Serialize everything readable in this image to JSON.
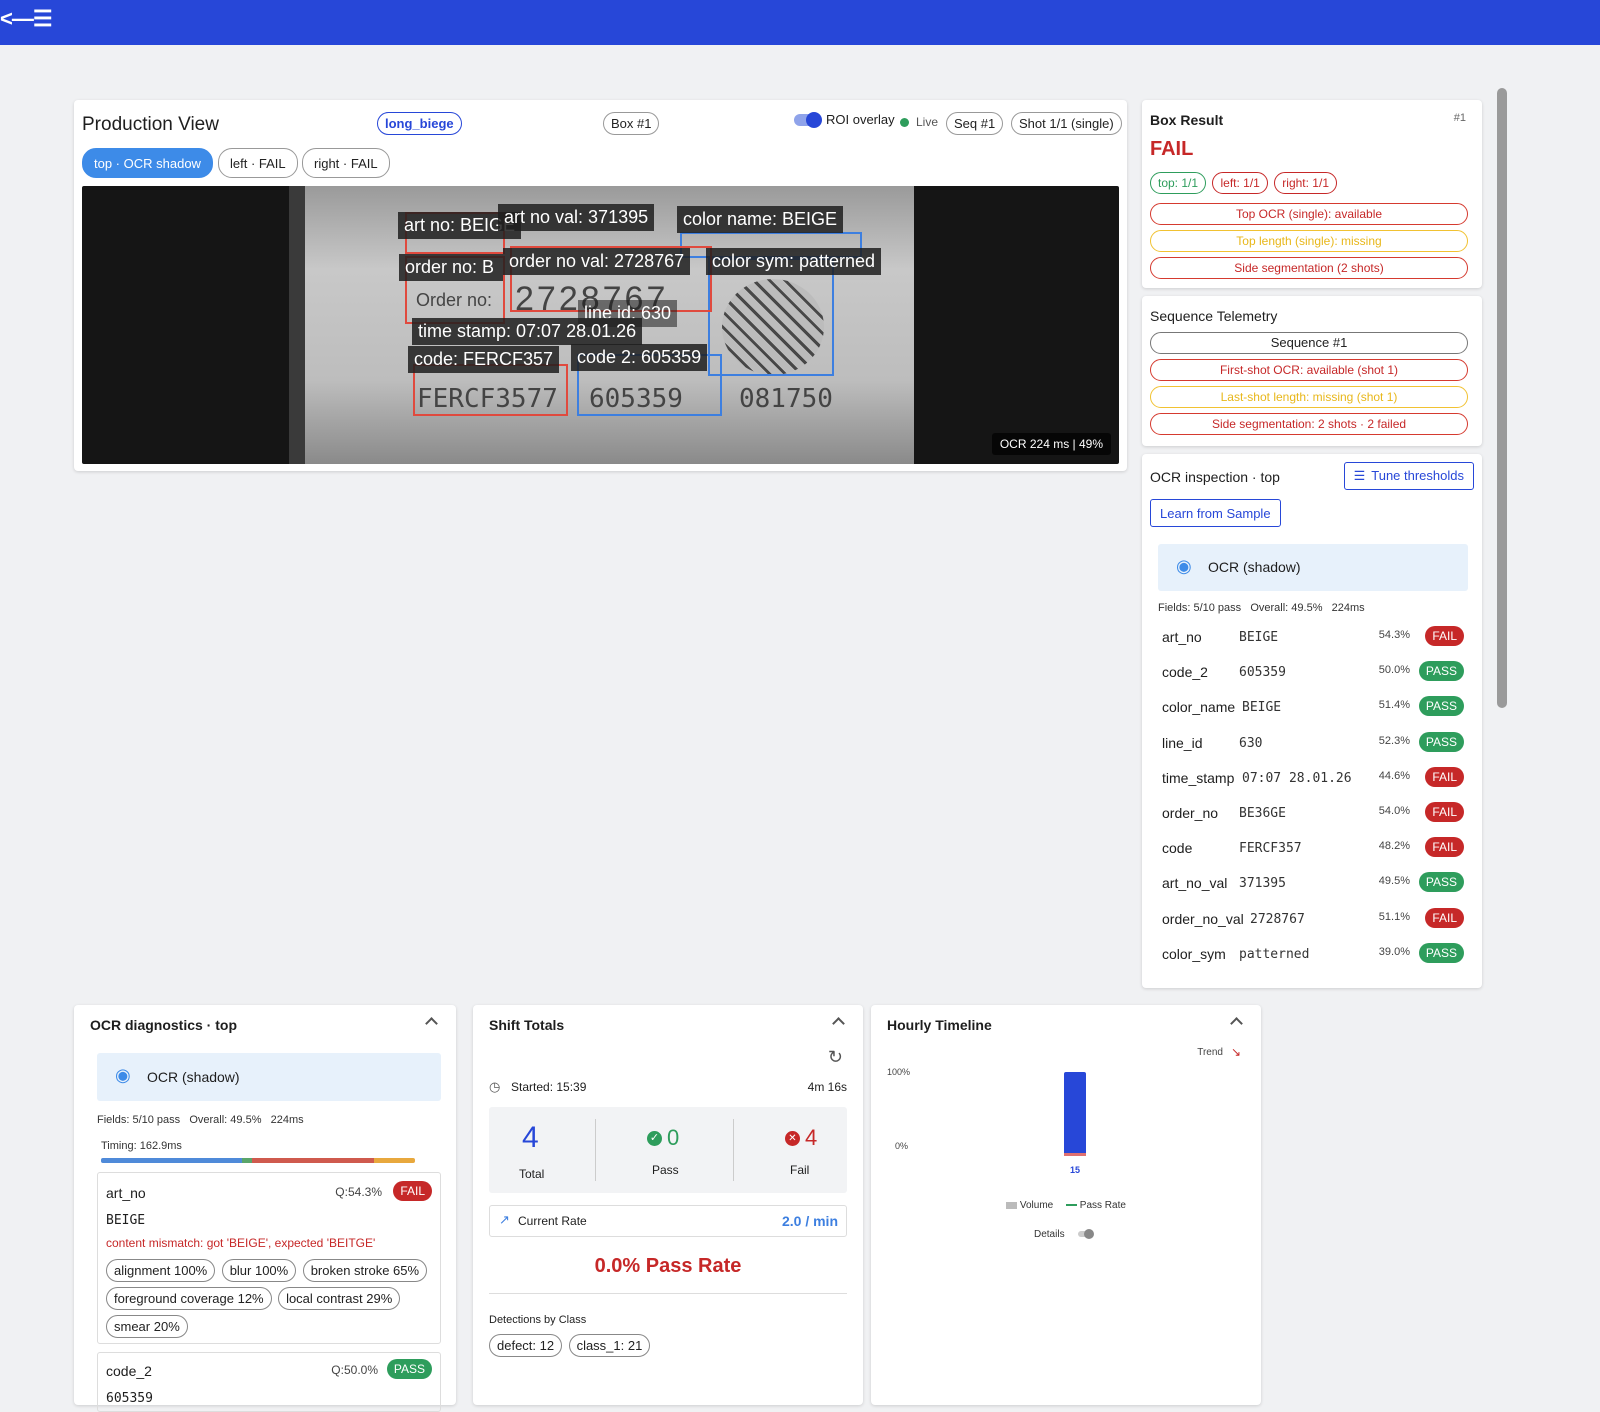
{
  "colors": {
    "brand": "#2747d8",
    "fail": "#c62828",
    "pass": "#2e9d5c",
    "warn": "#e8b71a",
    "info": "#3d7fe0"
  },
  "production": {
    "title": "Production View",
    "product_tag": "long_biege",
    "box": "Box #1",
    "roi_label": "ROI overlay",
    "live": "Live",
    "seq": "Seq #1",
    "shot": "Shot 1/1 (single)",
    "tabs": [
      "top · OCR shadow",
      "left · FAIL",
      "right · FAIL"
    ],
    "overlay_labels": {
      "art_no": "art no: BEIGE",
      "art_no_val": "art no val: 371395",
      "color_name": "color name: BEIGE",
      "order_no": "order no: B",
      "order_no_val": "order no val: 2728767",
      "color_sym": "color sym: patterned",
      "line_id": "line id: 630",
      "time_stamp": "time stamp: 07:07 28.01.26",
      "code": "code: FERCF357",
      "code_2": "code 2: 605359"
    },
    "image_texts": {
      "order_no": "Order no:",
      "number": "2728767",
      "fercf": "FERCF3577",
      "n1": "605359",
      "n2": "081750"
    },
    "ocr_timing": "OCR 224 ms | 49%"
  },
  "box_result": {
    "title": "Box Result",
    "num": "#1",
    "status": "FAIL",
    "chips": [
      "top: 1/1",
      "left: 1/1",
      "right: 1/1"
    ],
    "rows": [
      "Top OCR (single): available",
      "Top length (single): missing",
      "Side segmentation (2 shots)"
    ]
  },
  "telemetry": {
    "title": "Sequence Telemetry",
    "rows": [
      "Sequence #1",
      "First-shot OCR: available (shot 1)",
      "Last-shot length: missing (shot 1)",
      "Side segmentation: 2 shots · 2 failed"
    ]
  },
  "ocr_inspection": {
    "title": "OCR inspection · top",
    "tune": "Tune thresholds",
    "learn": "Learn from Sample",
    "mode": "OCR (shadow)",
    "summary": "Fields: 5/10 pass   Overall: 49.5%   224ms",
    "fields": [
      {
        "name": "art_no",
        "value": "BEIGE",
        "pct": "54.3%",
        "status": "FAIL"
      },
      {
        "name": "code_2",
        "value": "605359",
        "pct": "50.0%",
        "status": "PASS"
      },
      {
        "name": "color_name",
        "value": "BEIGE",
        "pct": "51.4%",
        "status": "PASS"
      },
      {
        "name": "line_id",
        "value": "630",
        "pct": "52.3%",
        "status": "PASS"
      },
      {
        "name": "time_stamp",
        "value": "07:07 28.01.26",
        "pct": "44.6%",
        "status": "FAIL"
      },
      {
        "name": "order_no",
        "value": "BE36GE",
        "pct": "54.0%",
        "status": "FAIL"
      },
      {
        "name": "code",
        "value": "FERCF357",
        "pct": "48.2%",
        "status": "FAIL"
      },
      {
        "name": "art_no_val",
        "value": "371395",
        "pct": "49.5%",
        "status": "PASS"
      },
      {
        "name": "order_no_val",
        "value": "2728767",
        "pct": "51.1%",
        "status": "FAIL"
      },
      {
        "name": "color_sym",
        "value": "patterned",
        "pct": "39.0%",
        "status": "PASS"
      }
    ]
  },
  "diagnostics": {
    "title": "OCR diagnostics · top",
    "mode": "OCR (shadow)",
    "summary": "Fields: 5/10 pass   Overall: 49.5%   224ms",
    "timing": "Timing: 162.9ms",
    "field1": {
      "name": "art_no",
      "q": "Q:54.3%",
      "status": "FAIL",
      "value": "BEIGE",
      "error": "content mismatch: got 'BEIGE', expected 'BEITGE'",
      "chips": [
        "alignment 100%",
        "blur 100%",
        "broken stroke 65%",
        "foreground coverage 12%",
        "local contrast 29%",
        "smear 20%"
      ]
    },
    "field2": {
      "name": "code_2",
      "q": "Q:50.0%",
      "status": "PASS",
      "value": "605359"
    }
  },
  "shift": {
    "title": "Shift Totals",
    "started": "Started: 15:39",
    "elapsed": "4m 16s",
    "total": "4",
    "total_label": "Total",
    "pass": "0",
    "pass_label": "Pass",
    "fail": "4",
    "fail_label": "Fail",
    "rate_label": "Current Rate",
    "rate": "2.0 / min",
    "pass_rate": "0.0% Pass Rate",
    "detections_label": "Detections by Class",
    "detections": [
      "defect: 12",
      "class_1: 21"
    ]
  },
  "timeline": {
    "title": "Hourly Timeline",
    "trend": "Trend",
    "details": "Details"
  },
  "chart_data": {
    "type": "bar",
    "categories": [
      "15"
    ],
    "series": [
      {
        "name": "Volume",
        "values": [
          100
        ]
      },
      {
        "name": "Pass Rate",
        "values": [
          0
        ]
      }
    ],
    "ytick_labels": [
      "100%",
      "0%"
    ],
    "ylim": [
      0,
      100
    ]
  }
}
